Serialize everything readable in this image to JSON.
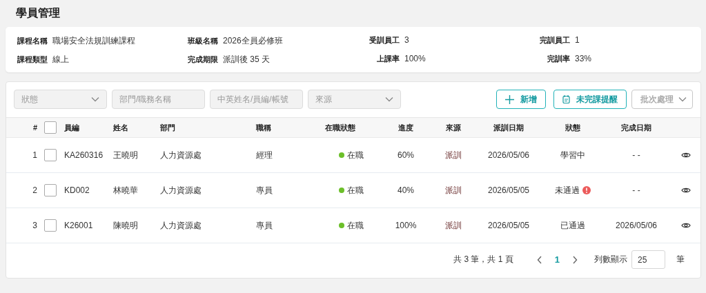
{
  "page_title": "學員管理",
  "info": [
    {
      "label": "課程名稱",
      "value": "職場安全法規訓練課程"
    },
    {
      "label": "班級名稱",
      "value": "2026全員必修班"
    },
    {
      "label": "受訓員工",
      "value": "3"
    },
    {
      "label": "完訓員工",
      "value": "1"
    },
    {
      "label": "課程類型",
      "value": "線上"
    },
    {
      "label": "完成期限",
      "value": "派訓後 35 天"
    },
    {
      "label": "上課率",
      "value": "100%"
    },
    {
      "label": "完訓率",
      "value": "33%"
    }
  ],
  "filters": [
    {
      "kind": "select",
      "placeholder": "狀態"
    },
    {
      "kind": "input",
      "placeholder": "部門/職務名稱"
    },
    {
      "kind": "input",
      "placeholder": "中英姓名/員編/帳號"
    },
    {
      "kind": "select",
      "placeholder": "來源"
    }
  ],
  "actions": [
    {
      "kind": "add",
      "label": "新增",
      "disabled": false
    },
    {
      "kind": "remind",
      "label": "未完課提醒",
      "disabled": false
    },
    {
      "kind": "batch",
      "label": "批次處理",
      "disabled": true
    }
  ],
  "table": {
    "columns": [
      "#",
      "員編",
      "姓名",
      "部門",
      "職稱",
      "在職狀態",
      "進度",
      "來源",
      "派訓日期",
      "狀態",
      "完成日期"
    ],
    "select_all_checked": false,
    "rows": [
      {
        "index": "1",
        "checked": false,
        "id": "KA260316",
        "name": "王曉明",
        "dept": "人力資源處",
        "title": "經理",
        "employment": "在職",
        "progress": "60%",
        "source": "派訓",
        "assigned": "2026/05/06",
        "status": "學習中",
        "alert": false,
        "completed": "- -"
      },
      {
        "index": "2",
        "checked": false,
        "id": "KD002",
        "name": "林曉華",
        "dept": "人力資源處",
        "title": "專員",
        "employment": "在職",
        "progress": "40%",
        "source": "派訓",
        "assigned": "2026/05/05",
        "status": "未通過",
        "alert": true,
        "completed": "- -"
      },
      {
        "index": "3",
        "checked": false,
        "id": "K26001",
        "name": "陳曉明",
        "dept": "人力資源處",
        "title": "專員",
        "employment": "在職",
        "progress": "100%",
        "source": "派訓",
        "assigned": "2026/05/05",
        "status": "已通過",
        "alert": false,
        "completed": "2026/05/06"
      }
    ]
  },
  "pagination": {
    "summary": "共 3 筆，共 1 頁",
    "pages": [
      {
        "label": "1",
        "selected": true
      }
    ],
    "page_size_label": "列數顯示",
    "page_size": "25",
    "unit": "筆"
  }
}
